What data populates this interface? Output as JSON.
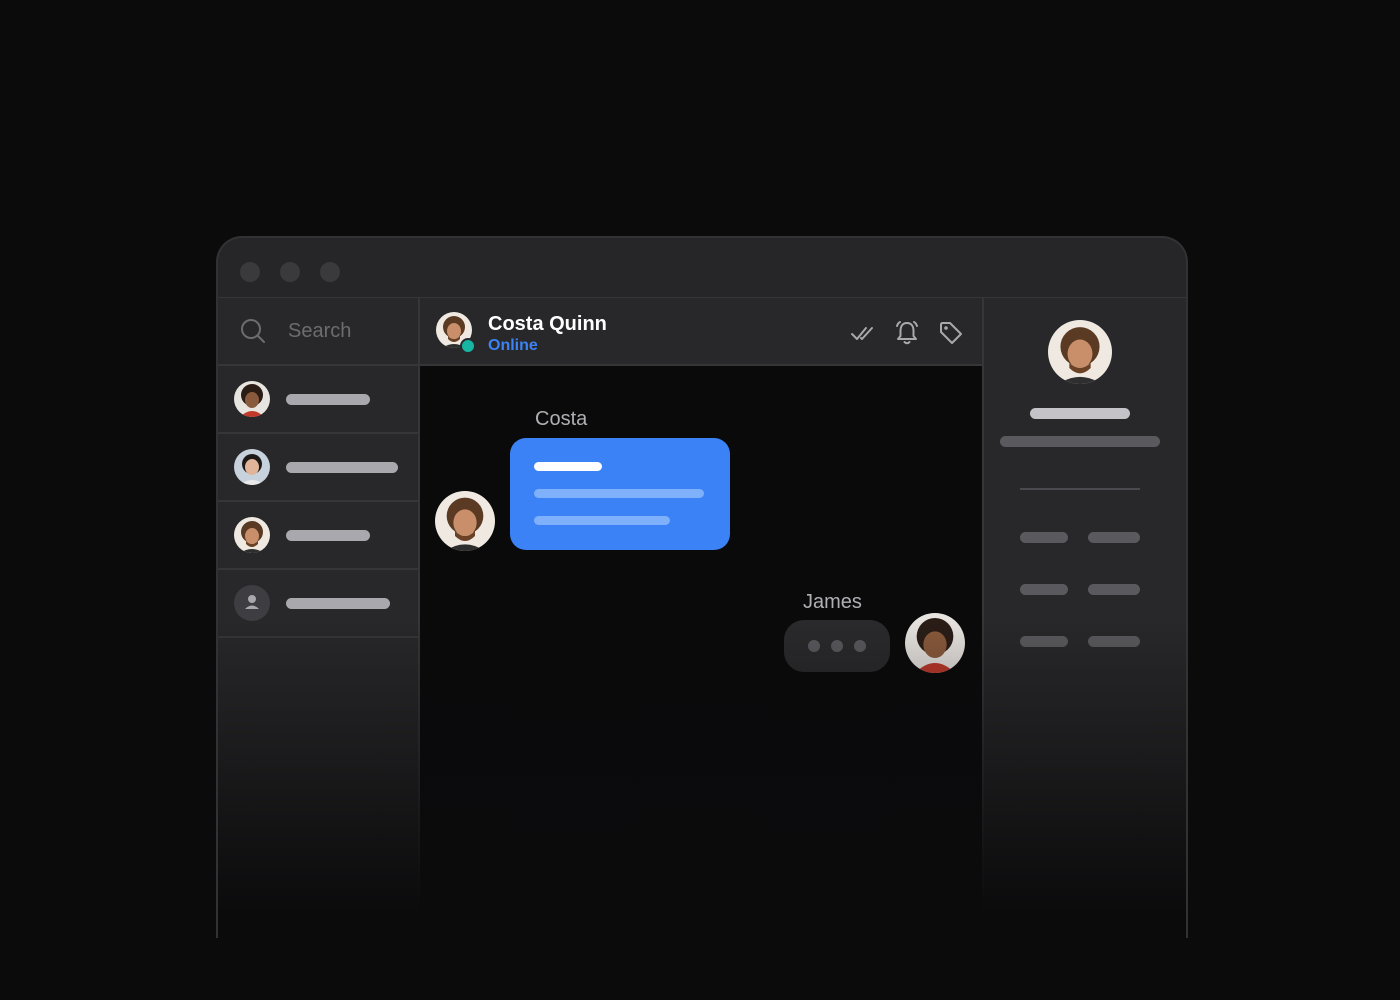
{
  "sidebar": {
    "search_placeholder": "Search"
  },
  "chat": {
    "contact_name": "Costa Quinn",
    "contact_status": "Online",
    "messages": [
      {
        "sender": "Costa"
      },
      {
        "sender": "James"
      }
    ]
  },
  "colors": {
    "accent": "#3b82f6",
    "online": "#16b6a3",
    "background": "#0b0b0c",
    "panel": "#28282a"
  },
  "icons": [
    "search-icon",
    "double-check-icon",
    "bell-icon",
    "tag-icon",
    "user-icon"
  ]
}
